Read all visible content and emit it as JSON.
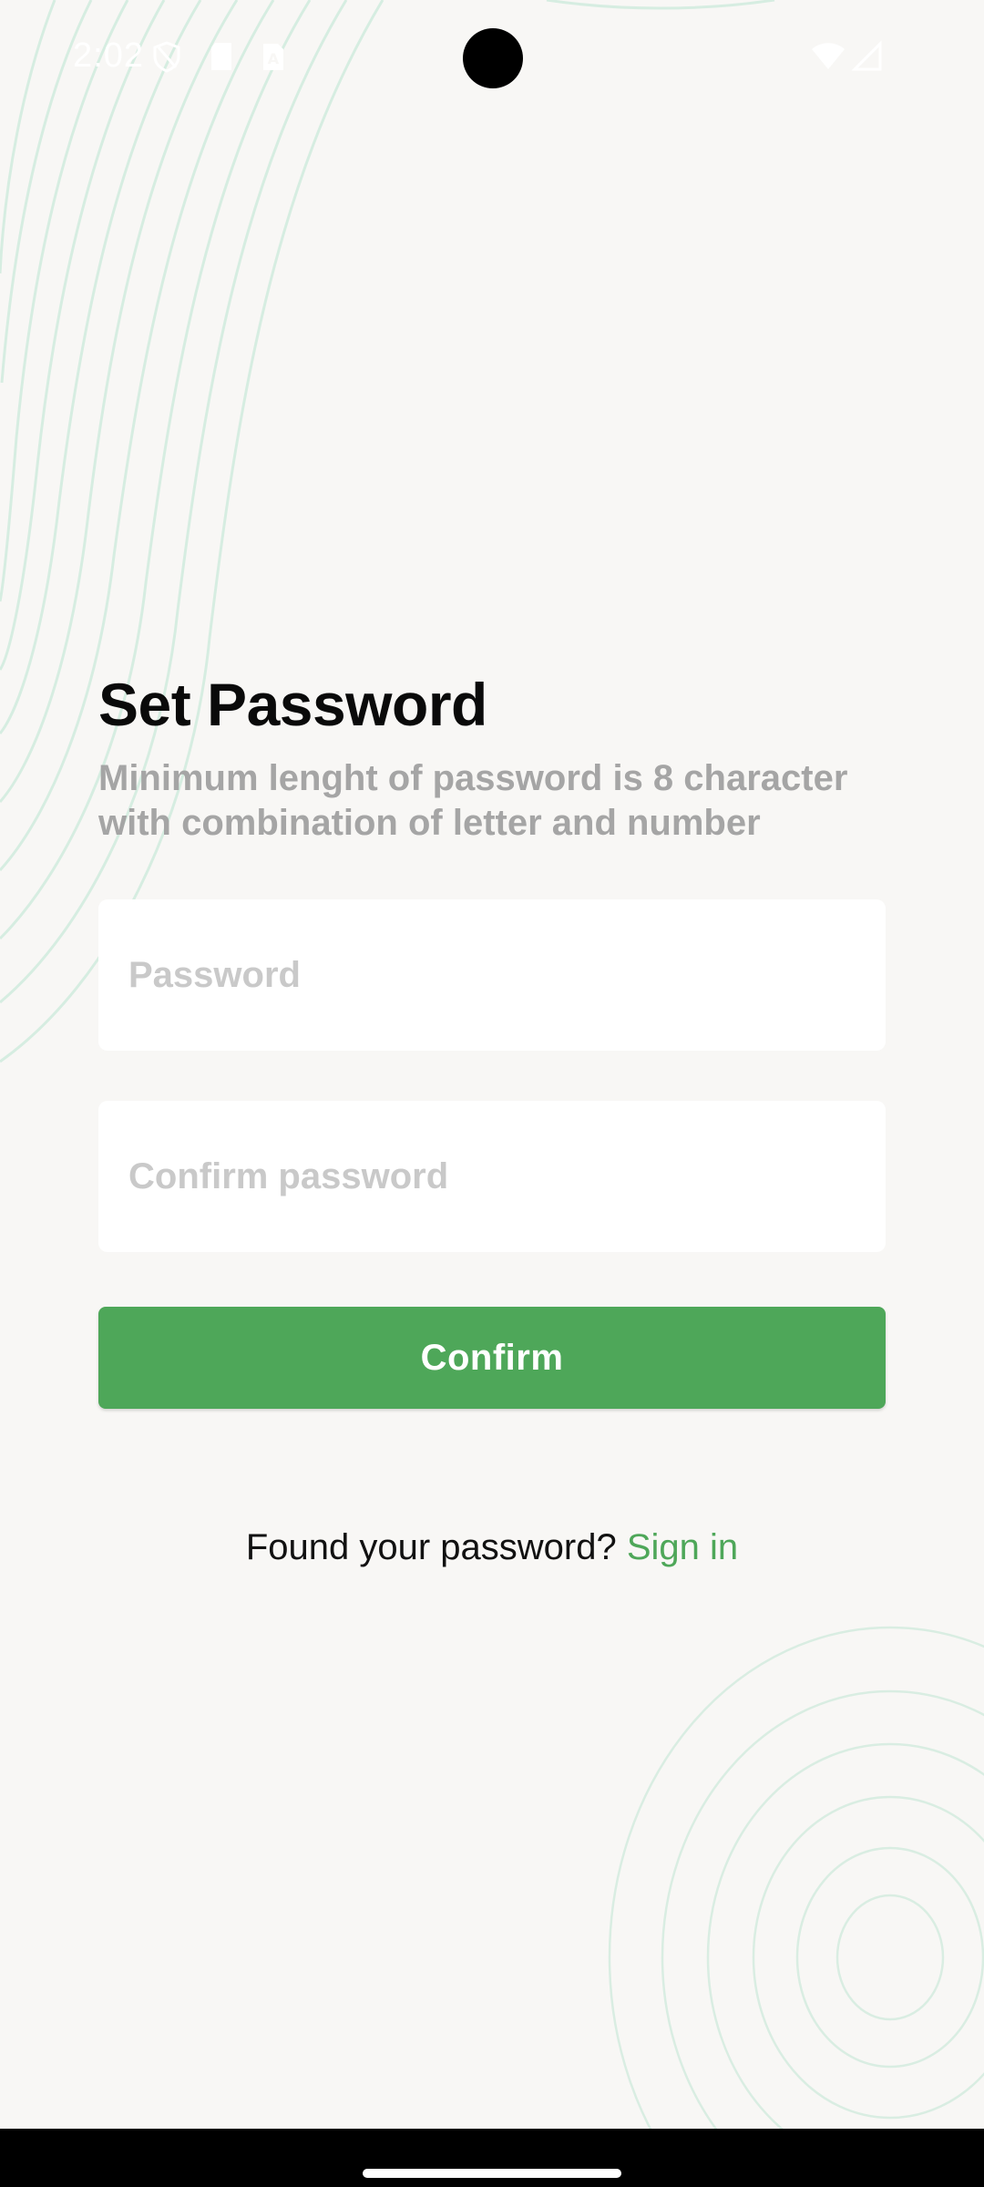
{
  "status_bar": {
    "time": "2:02"
  },
  "screen": {
    "title": "Set Password",
    "subtitle": "Minimum lenght of password is 8 character with combination of letter and number",
    "password_field": {
      "value": "",
      "placeholder": "Password"
    },
    "confirm_password_field": {
      "value": "",
      "placeholder": "Confirm password"
    },
    "confirm_button": "Confirm",
    "footer": {
      "prompt": "Found your password?",
      "link": "Sign in"
    }
  },
  "colors": {
    "accent": "#4ea759",
    "background": "#f8f7f5",
    "decor_lines": "#d6ede1"
  }
}
